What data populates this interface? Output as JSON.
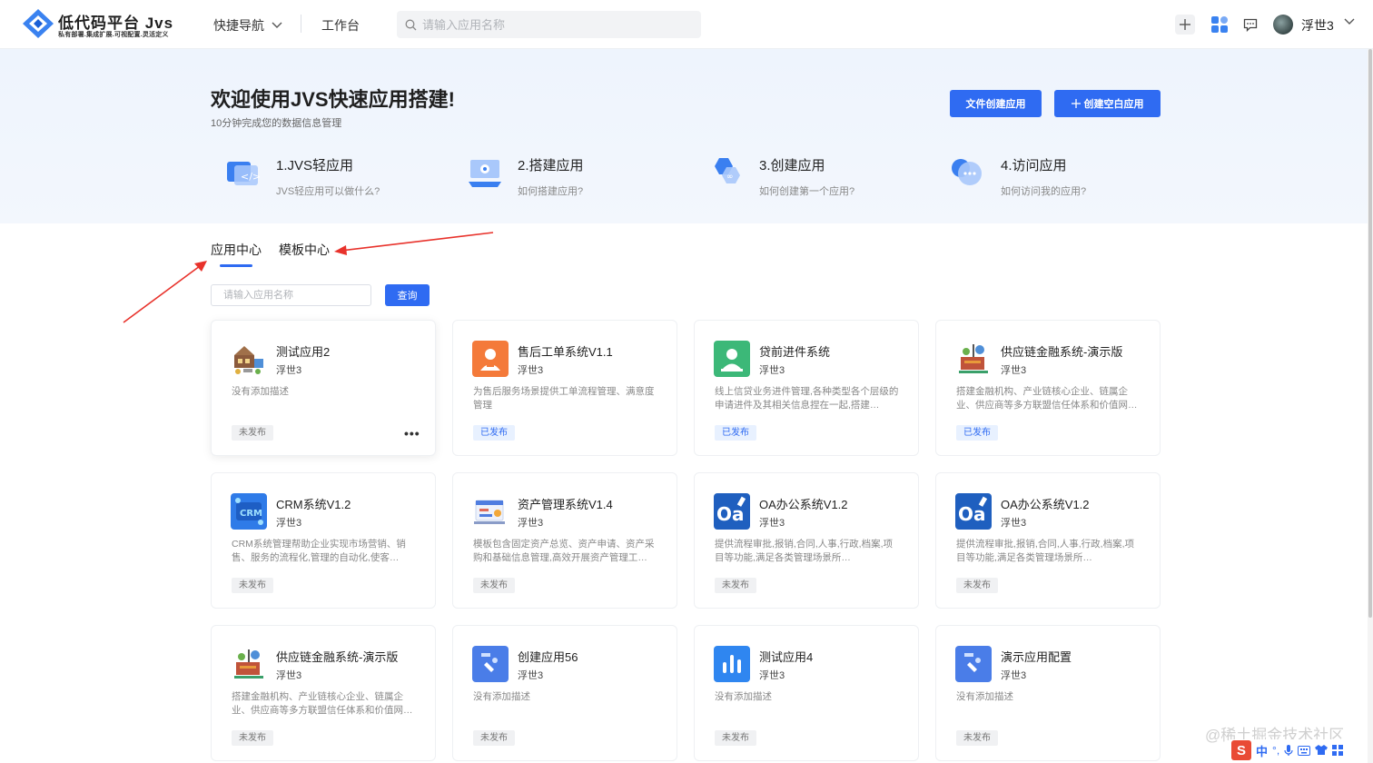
{
  "header": {
    "brand_title": "低代码平台 Jvs",
    "brand_subtitle": "私有部署.集成扩展.可视配置.灵活定义",
    "quick_nav": "快捷导航",
    "workbench": "工作台",
    "search_placeholder": "请输入应用名称",
    "user_name": "浮世3"
  },
  "banner": {
    "welcome": "欢迎使用JVS快速应用搭建!",
    "subtitle": "10分钟完成您的数据信息管理",
    "btn_file": "文件创建应用",
    "btn_blank": "创建空白应用",
    "steps": [
      {
        "title": "1.JVS轻应用",
        "sub": "JVS轻应用可以做什么?"
      },
      {
        "title": "2.搭建应用",
        "sub": "如何搭建应用?"
      },
      {
        "title": "3.创建应用",
        "sub": "如何创建第一个应用?"
      },
      {
        "title": "4.访问应用",
        "sub": "如何访问我的应用?"
      }
    ]
  },
  "tabs": {
    "app_center": "应用中心",
    "template_center": "模板中心"
  },
  "filter": {
    "placeholder": "请输入应用名称",
    "query": "查询"
  },
  "cards": [
    {
      "title": "测试应用2",
      "owner": "浮世3",
      "desc": "没有添加描述",
      "status": "未发布",
      "icon": "factory-icon"
    },
    {
      "title": "售后工单系统V1.1",
      "owner": "浮世3",
      "desc": "为售后服务场景提供工单流程管理、满意度管理",
      "status": "已发布",
      "icon": "service-person-icon",
      "color": "#f47a3a"
    },
    {
      "title": "贷前进件系统",
      "owner": "浮世3",
      "desc": "线上信贷业务进件管理,各种类型各个层级的申请进件及其相关信息捏在一起,搭建…",
      "status": "已发布",
      "icon": "loan-person-icon",
      "color": "#3cb878"
    },
    {
      "title": "供应链金融系统-演示版",
      "owner": "浮世3",
      "desc": "搭建金融机构、产业链核心企业、链属企业、供应商等多方联盟信任体系和价值网…",
      "status": "已发布",
      "icon": "supply-chain-icon"
    },
    {
      "title": "CRM系统V1.2",
      "owner": "浮世3",
      "desc": "CRM系统管理帮助企业实现市场营销、销售、服务的流程化,管理的自动化,使客…",
      "status": "未发布",
      "icon": "crm-icon",
      "color": "#2f7be8"
    },
    {
      "title": "资产管理系统V1.4",
      "owner": "浮世3",
      "desc": "模板包含固定资产总览、资产申请、资产采购和基础信息管理,高效开展资产管理工…",
      "status": "未发布",
      "icon": "asset-icon"
    },
    {
      "title": "OA办公系统V1.2",
      "owner": "浮世3",
      "desc": "提供流程审批,报销,合同,人事,行政,档案,项目等功能,满足各类管理场景所…",
      "status": "未发布",
      "icon": "oa-icon",
      "color": "#1f5fbf"
    },
    {
      "title": "OA办公系统V1.2",
      "owner": "浮世3",
      "desc": "提供流程审批,报销,合同,人事,行政,档案,项目等功能,满足各类管理场景所…",
      "status": "未发布",
      "icon": "oa-icon",
      "color": "#1f5fbf"
    },
    {
      "title": "供应链金融系统-演示版",
      "owner": "浮世3",
      "desc": "搭建金融机构、产业链核心企业、链属企业、供应商等多方联盟信任体系和价值网…",
      "status": "未发布",
      "icon": "supply-chain-icon"
    },
    {
      "title": "创建应用56",
      "owner": "浮世3",
      "desc": "没有添加描述",
      "status": "未发布",
      "icon": "app-default-icon",
      "color": "#4a7de8"
    },
    {
      "title": "测试应用4",
      "owner": "浮世3",
      "desc": "没有添加描述",
      "status": "未发布",
      "icon": "bar-chart-icon",
      "color": "#2f86f0"
    },
    {
      "title": "演示应用配置",
      "owner": "浮世3",
      "desc": "没有添加描述",
      "status": "未发布",
      "icon": "app-default-icon",
      "color": "#4a7de8"
    }
  ],
  "more_label": "•••",
  "watermark": "@稀土掘金技术社区",
  "ime": {
    "s": "S",
    "lang": "中"
  },
  "colors": {
    "primary": "#2f6bf2",
    "banner_bg": "#eef4fd",
    "published_bg": "#e8f1ff"
  }
}
